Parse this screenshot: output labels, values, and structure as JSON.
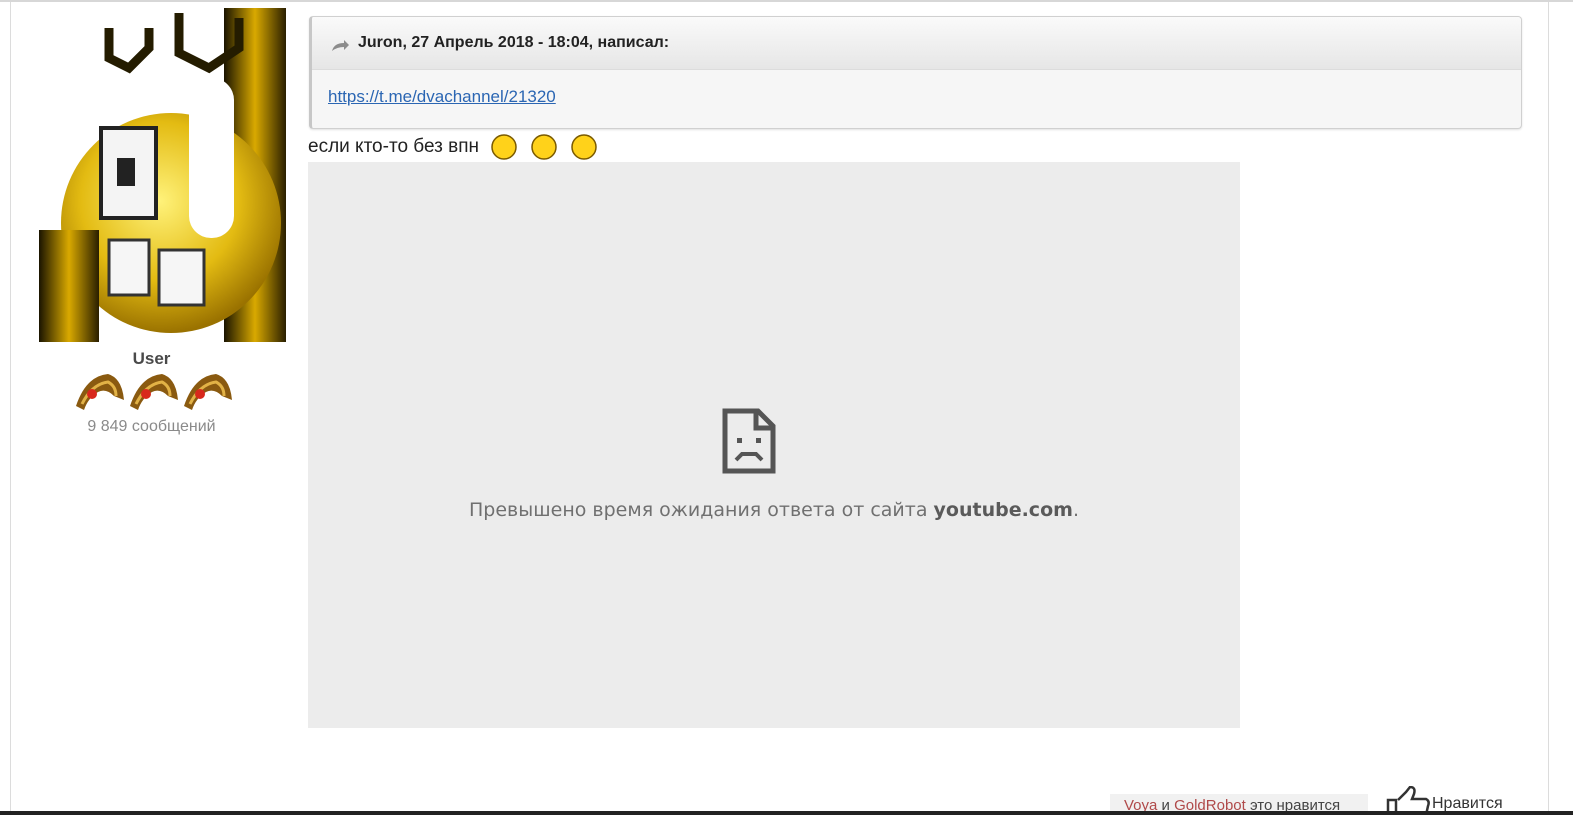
{
  "author": {
    "group": "User",
    "post_count": "9 849 сообщений"
  },
  "quote": {
    "citation": "Juron, 27 Апрель 2018 - 18:04, написал:",
    "link_text": "https://t.me/dvachannel/21320"
  },
  "post": {
    "text": "если кто-то без впн",
    "smileys": [
      "smiley",
      "smiley",
      "smiley"
    ]
  },
  "embed": {
    "message_prefix": "Превышено время ожидания ответа от сайта ",
    "message_domain": "youtube.com",
    "message_suffix": "."
  },
  "likes": {
    "user1": "Voya",
    "and": " и ",
    "user2": "GoldRobot",
    "suffix": " это нравится",
    "button_label": "Нравится"
  },
  "colors": {
    "link": "#2b66b3",
    "username": "#b04a4a",
    "embed_bg": "#ececec"
  }
}
